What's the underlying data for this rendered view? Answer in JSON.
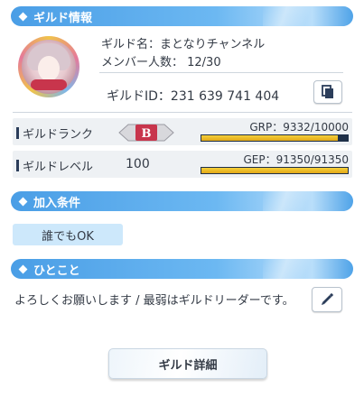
{
  "sections": {
    "guild_info": "ギルド情報",
    "join_conditions": "加入条件",
    "comment": "ひとこと"
  },
  "guild": {
    "name_line": "ギルド名：まとなりチャンネル",
    "members_line": "メンバー人数：  12/30",
    "id_line": "ギルドID：231 639 741 404",
    "rank_label": "ギルドランク",
    "rank_value": "B",
    "grp_text": "GRP：9332/10000",
    "grp_current": 9332,
    "grp_max": 10000,
    "level_label": "ギルドレベル",
    "level_value": "100",
    "gep_text": "GEP：91350/91350",
    "gep_current": 91350,
    "gep_max": 91350
  },
  "join": {
    "condition": "誰でもOK"
  },
  "comment": {
    "text": "よろしくお願いします / 最弱はギルドリーダーです。"
  },
  "buttons": {
    "detail": "ギルド詳細"
  },
  "icons": {
    "copy": "copy-icon",
    "edit": "pencil-icon",
    "avatar": "guild-avatar"
  },
  "colors": {
    "header_blue": "#4a9ee6",
    "progress_gold": "#f5cf3a",
    "progress_track": "#1f3048",
    "rank_red": "#c8354c",
    "chip_blue": "#cde8fb"
  }
}
